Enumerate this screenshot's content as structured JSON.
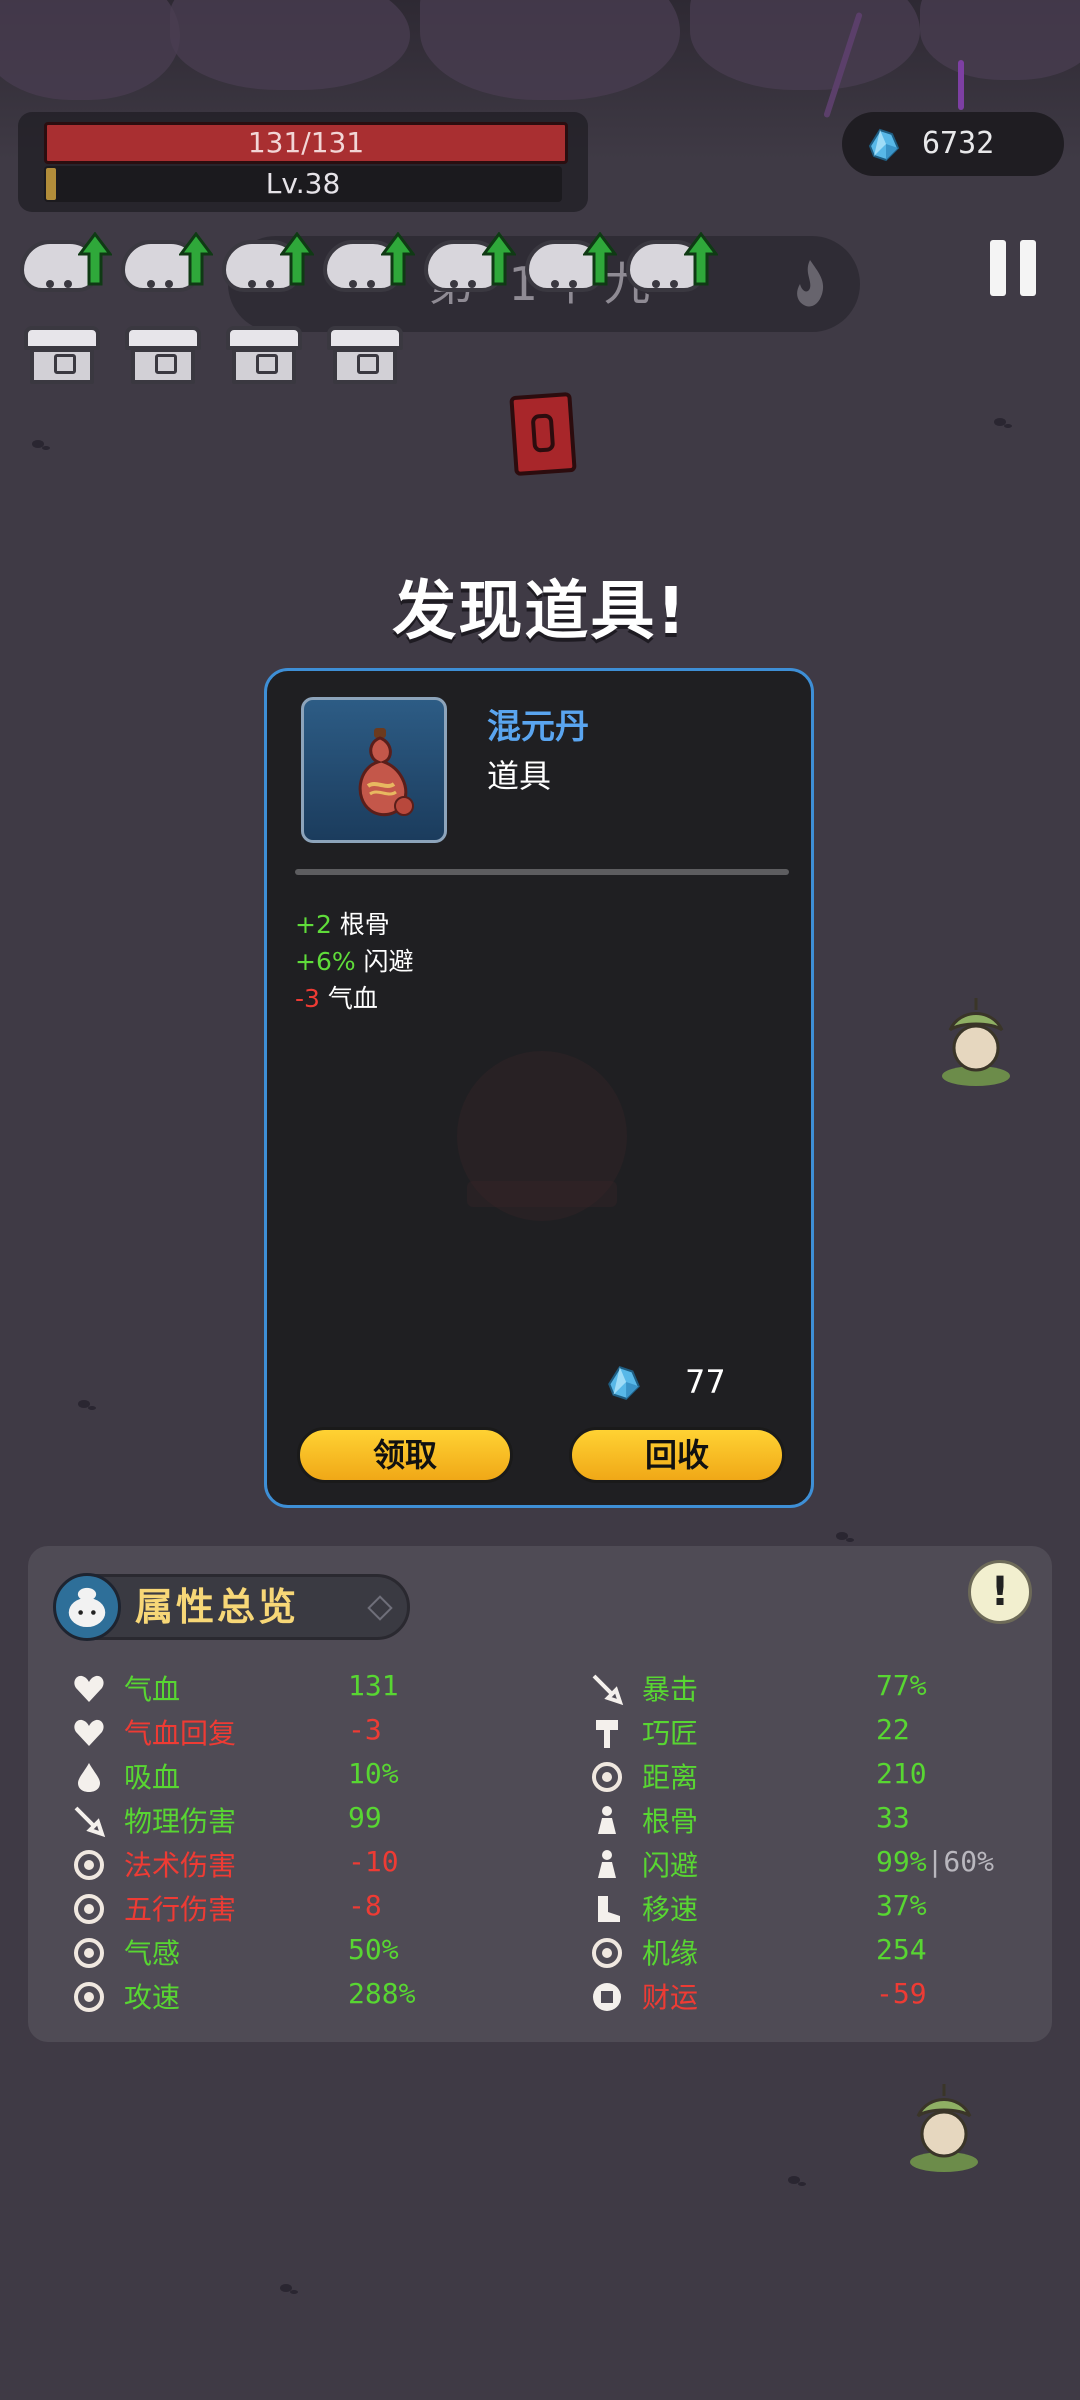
{
  "hud": {
    "hp_text": "131/131",
    "level_text": "Lv.38",
    "level_progress": 0.02,
    "gem_count": "6732"
  },
  "banner": {
    "text": "第 1个九"
  },
  "upgrades": {
    "upgrade_icon": "cloud-spirit-up-arrow-icon",
    "count": 7,
    "chest_icon": "treasure-chest-icon",
    "chest_count": 4
  },
  "kill_counter": "0",
  "dialog": {
    "title": "发现道具!",
    "item": {
      "name": "混元丹",
      "type": "道具",
      "icon": "gourd-icon",
      "effects": [
        {
          "value": "+2",
          "label": "根骨",
          "sign": "pos"
        },
        {
          "value": "+6%",
          "label": "闪避",
          "sign": "pos"
        },
        {
          "value": "-3",
          "label": "气血",
          "sign": "neg"
        }
      ],
      "price": "77",
      "price_icon": "crystal-gem-icon"
    },
    "buttons": {
      "claim": "领取",
      "recycle": "回收"
    }
  },
  "stats": {
    "title": "属性总览",
    "info_glyph": "!",
    "left": [
      {
        "icon": "heart-icon",
        "name": "气血",
        "value": "131",
        "color": "green"
      },
      {
        "icon": "heart-regen-icon",
        "name": "气血回复",
        "value": "-3",
        "color": "red"
      },
      {
        "icon": "blood-drop-icon",
        "name": "吸血",
        "value": "10%",
        "color": "green"
      },
      {
        "icon": "sword-icon",
        "name": "物理伤害",
        "value": "99",
        "color": "green"
      },
      {
        "icon": "spiral-icon",
        "name": "法术伤害",
        "value": "-10",
        "color": "red"
      },
      {
        "icon": "five-elements-icon",
        "name": "五行伤害",
        "value": "-8",
        "color": "red"
      },
      {
        "icon": "qi-sense-icon",
        "name": "气感",
        "value": "50%",
        "color": "green"
      },
      {
        "icon": "attack-speed-icon",
        "name": "攻速",
        "value": "288%",
        "color": "green"
      }
    ],
    "right": [
      {
        "icon": "crit-icon",
        "name": "暴击",
        "value": "77%",
        "color": "green"
      },
      {
        "icon": "hammer-icon",
        "name": "巧匠",
        "value": "22",
        "color": "green"
      },
      {
        "icon": "range-icon",
        "name": "距离",
        "value": "210",
        "color": "green"
      },
      {
        "icon": "body-icon",
        "name": "根骨",
        "value": "33",
        "color": "green"
      },
      {
        "icon": "dodge-icon",
        "name": "闪避",
        "value": "99%",
        "extra": "|60%",
        "color": "green"
      },
      {
        "icon": "boot-icon",
        "name": "移速",
        "value": "37%",
        "color": "green"
      },
      {
        "icon": "fortune-clover-icon",
        "name": "机缘",
        "value": "254",
        "color": "green"
      },
      {
        "icon": "coin-icon",
        "name": "财运",
        "value": "-59",
        "color": "red"
      }
    ]
  },
  "colors": {
    "background": "#3f3a45",
    "hp_red": "#a92f31",
    "card_border": "#3e8fd6",
    "item_name_blue": "#5aa5f0",
    "positive_green": "#58d632",
    "negative_red": "#ee3b34",
    "button_yellow": "#f5b91f",
    "stats_title_gold": "#f7d777"
  }
}
